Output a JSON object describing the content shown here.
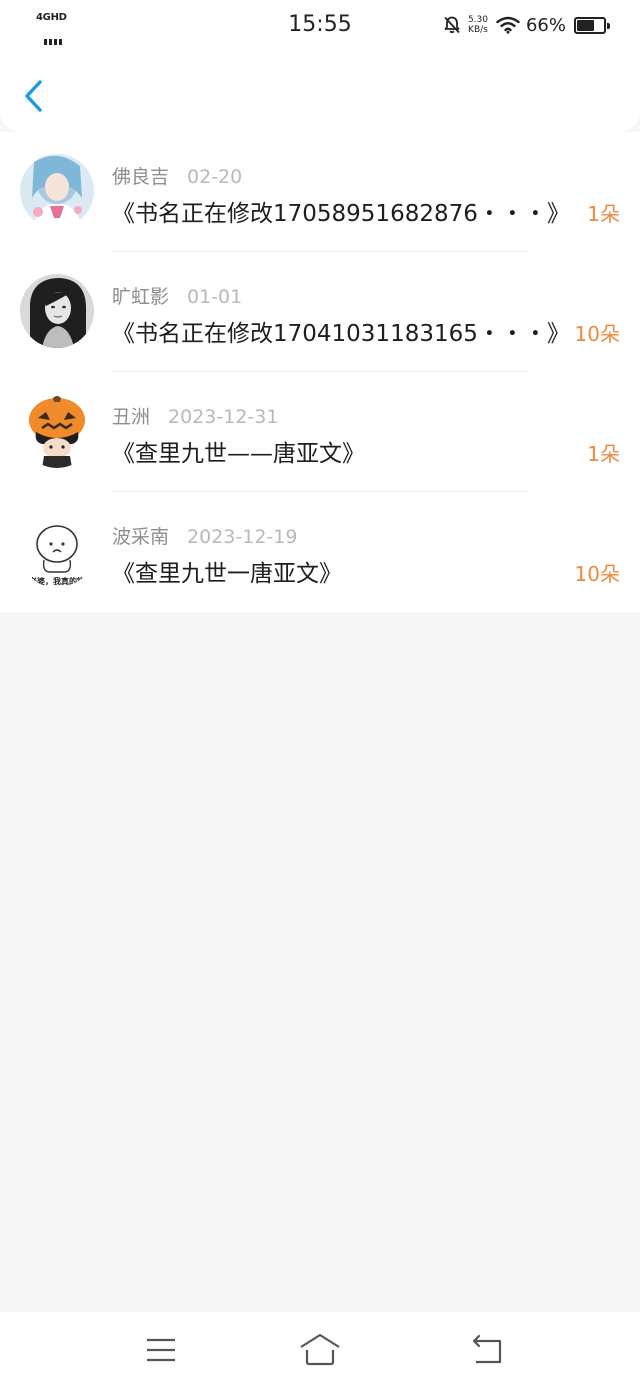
{
  "status_bar": {
    "network": "4GHD",
    "time": "15:55",
    "speed_value": "5.30",
    "speed_unit": "KB/s",
    "battery": "66%"
  },
  "header": {
    "back_icon": "chevron-left-icon"
  },
  "items": [
    {
      "name": "佛良吉",
      "date": "02-20",
      "title": "《书名正在修改17058951682876・・・》",
      "amount": "1朵"
    },
    {
      "name": "旷虹影",
      "date": "01-01",
      "title": "《书名正在修改17041031183165・・・》",
      "amount": "10朵"
    },
    {
      "name": "丑洲",
      "date": "2023-12-31",
      "title": "《查里九世——唐亚文》",
      "amount": "1朵"
    },
    {
      "name": "波采南",
      "date": "2023-12-19",
      "title": "《查里九世一唐亚文》",
      "amount": "10朵",
      "avatar_caption": "老婆，我真的错"
    }
  ],
  "nav": {
    "menu_icon": "menu-icon",
    "home_icon": "home-icon",
    "back_icon": "back-icon"
  },
  "colors": {
    "accent": "#1a9be8",
    "amount": "#f08a3b",
    "background": "#f8f7f8"
  }
}
